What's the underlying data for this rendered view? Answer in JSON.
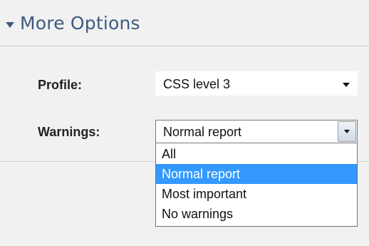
{
  "section": {
    "title": "More Options"
  },
  "profile": {
    "label": "Profile:",
    "selected": "CSS level 3"
  },
  "warnings": {
    "label": "Warnings:",
    "selected": "Normal report",
    "options": [
      "All",
      "Normal report",
      "Most important",
      "No warnings"
    ],
    "highlighted_option": "Normal report"
  },
  "colors": {
    "header_text": "#3d5a80",
    "highlight": "#3399ff",
    "background": "#f1f1f1"
  },
  "icons": {
    "section_toggle": "triangle-down-icon",
    "profile_dropdown": "chevron-down-icon",
    "warnings_dropdown": "chevron-down-icon"
  }
}
